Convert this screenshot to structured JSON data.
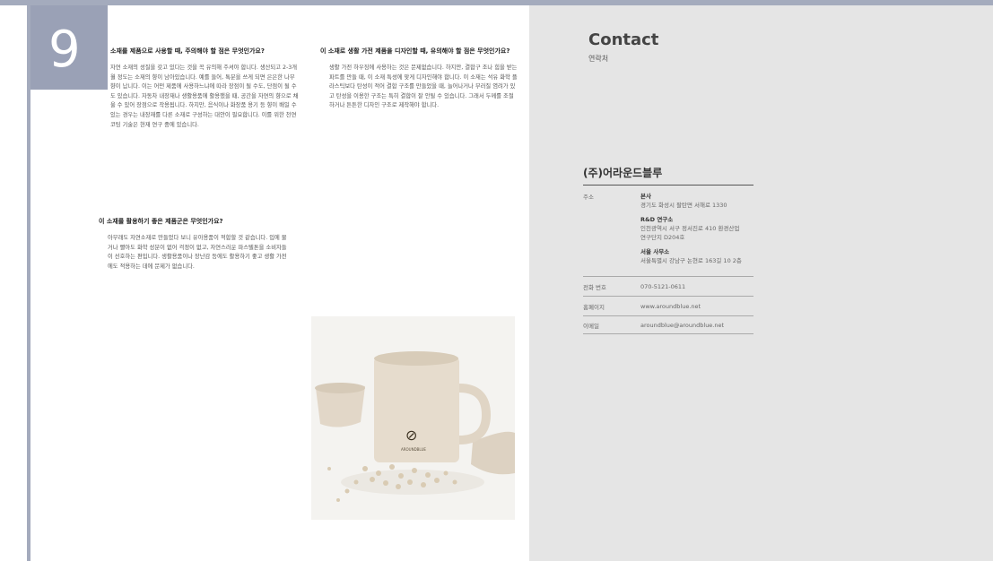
{
  "page_number": "9",
  "questions": [
    {
      "title": "소재를 제품으로 사용할 때, 주의해야 할 점은 무엇인가요?",
      "body": "자연 소재의 성질을 갖고 있다는 것을 꼭 유의해 주셔야 합니다. 생산되고 2-3개월 정도는 소재의 향이 남아있습니다. 예를 들어, 톡분을 쓰게 되면 은은한 나무 향이 납니다. 이는 어떤 제품에 사용하느냐에 따라 장점이 될 수도, 단점이 될 수도 있습니다. 자동차 내장재나 생활용품에 활용했을 때, 공간을 자연의 향으로 채울 수 있어 장점으로 작용됩니다. 하지만, 음식이나 화장품 용기 등 향이 배일 수 있는 경우는 내장재를 다른 소재로 구성하는 대안이 필요합니다. 이를 위한 천연 코팅 기술은 현재 연구 중에 있습니다."
    },
    {
      "title": "이 소재로 생활 가전 제품을 디자인할 때, 유의해야 할 점은 무엇인가요?",
      "body": "생활 가전 하우징에 사용하는 것은 문제없습니다. 하지만, 결합구 조나 힘을 받는 파트를 만들 때, 이 소재 특성에 맞게 디자인해야 합니다. 이 소재는 석유 화학 플라스틱보다 탄성이 적어 결합 구조를 만들었을 때, 늘어나거나 부러질 염려가 있고 탄성을 이용한 구조는 특히 결합이 잘 안될 수 있습니다. 그래서 두께를 조절하거나 튼튼한 디자인 구조로 제작해야 합니다."
    },
    {
      "title": "이 소재를 활용하기 좋은 제품군은 무엇인가요?",
      "body": "아무래도 자연소재로 만들었다 보니 유아용품이 적합할 것 같습니다. 입에 물거나 빨아도 화학 성분이 없어 걱정이 없고, 자연스러운 파스텔톤을 소비자들이 선호하는 편입니다. 생활용품이나 장난감 등에도 활용하기 좋고 생활 가전에도 적용하는 데에 문제가 없습니다."
    }
  ],
  "contact": {
    "title": "Contact",
    "subtitle": "연락처",
    "company": "(주)어라운드블루",
    "address_label": "주소",
    "addresses": [
      {
        "name": "본사",
        "line1": "경기도 화성시 팔탄면 서해로 1330",
        "line2": ""
      },
      {
        "name": "R&D 연구소",
        "line1": "인천광역시 서구 정서진로 410 환경산업",
        "line2": "연구단지 D204호"
      },
      {
        "name": "서울 사무소",
        "line1": "서울특별시 강남구 논현로 163길 10 2층",
        "line2": ""
      }
    ],
    "phone_label": "전화 번호",
    "phone": "070-5121-0611",
    "web_label": "홈페이지",
    "web": "www.aroundblue.net",
    "email_label": "이메일",
    "email": "aroundblue@aroundblue.net"
  },
  "photo": {
    "mug_logo_caption": "AROUNDBLUE"
  }
}
